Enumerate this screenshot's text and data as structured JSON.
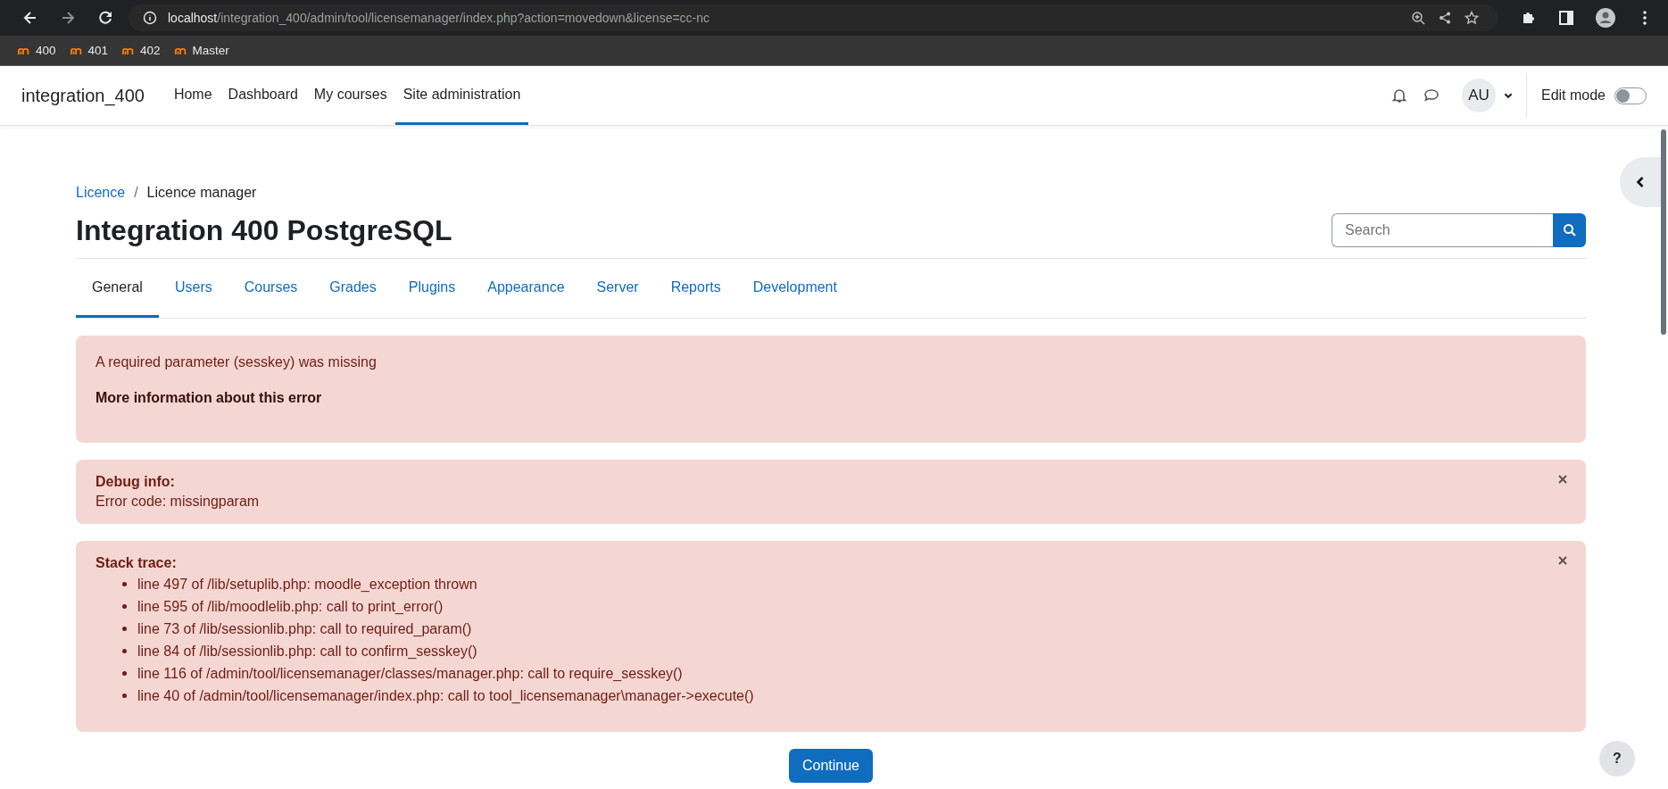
{
  "browser": {
    "url_host": "localhost",
    "url_path": "/integration_400/admin/tool/licensemanager/index.php?action=movedown&license=cc-nc",
    "bookmarks": [
      {
        "label": "400"
      },
      {
        "label": "401"
      },
      {
        "label": "402"
      },
      {
        "label": "Master"
      }
    ]
  },
  "navbar": {
    "site_name": "integration_400",
    "items": [
      {
        "label": "Home",
        "selected": false
      },
      {
        "label": "Dashboard",
        "selected": false
      },
      {
        "label": "My courses",
        "selected": false
      },
      {
        "label": "Site administration",
        "selected": true
      }
    ],
    "avatar": "AU",
    "edit_mode": {
      "label": "Edit mode",
      "on": false
    }
  },
  "breadcrumb": [
    {
      "label": "Licence",
      "link": true
    },
    {
      "label": "Licence manager",
      "link": false
    }
  ],
  "breadcrumb_separator": "/",
  "page_title": "Integration 400 PostgreSQL",
  "search": {
    "placeholder": "Search"
  },
  "tabs": [
    {
      "label": "General",
      "selected": true
    },
    {
      "label": "Users",
      "selected": false
    },
    {
      "label": "Courses",
      "selected": false
    },
    {
      "label": "Grades",
      "selected": false
    },
    {
      "label": "Plugins",
      "selected": false
    },
    {
      "label": "Appearance",
      "selected": false
    },
    {
      "label": "Server",
      "selected": false
    },
    {
      "label": "Reports",
      "selected": false
    },
    {
      "label": "Development",
      "selected": false
    }
  ],
  "alerts": [
    {
      "kind": "message",
      "text": "A required parameter (sesskey) was missing",
      "more": "More information about this error",
      "closable": false
    },
    {
      "kind": "debug",
      "heading": "Debug info:",
      "text": "Error code: missingparam",
      "closable": true
    },
    {
      "kind": "trace",
      "heading": "Stack trace:",
      "lines": [
        "line 497 of /lib/setuplib.php: moodle_exception thrown",
        "line 595 of /lib/moodlelib.php: call to print_error()",
        "line 73 of /lib/sessionlib.php: call to required_param()",
        "line 84 of /lib/sessionlib.php: call to confirm_sesskey()",
        "line 116 of /admin/tool/licensemanager/classes/manager.php: call to require_sesskey()",
        "line 40 of /admin/tool/licensemanager/index.php: call to tool_licensemanager\\manager->execute()"
      ],
      "closable": true
    }
  ],
  "continue_button": "Continue",
  "help_button": "?"
}
